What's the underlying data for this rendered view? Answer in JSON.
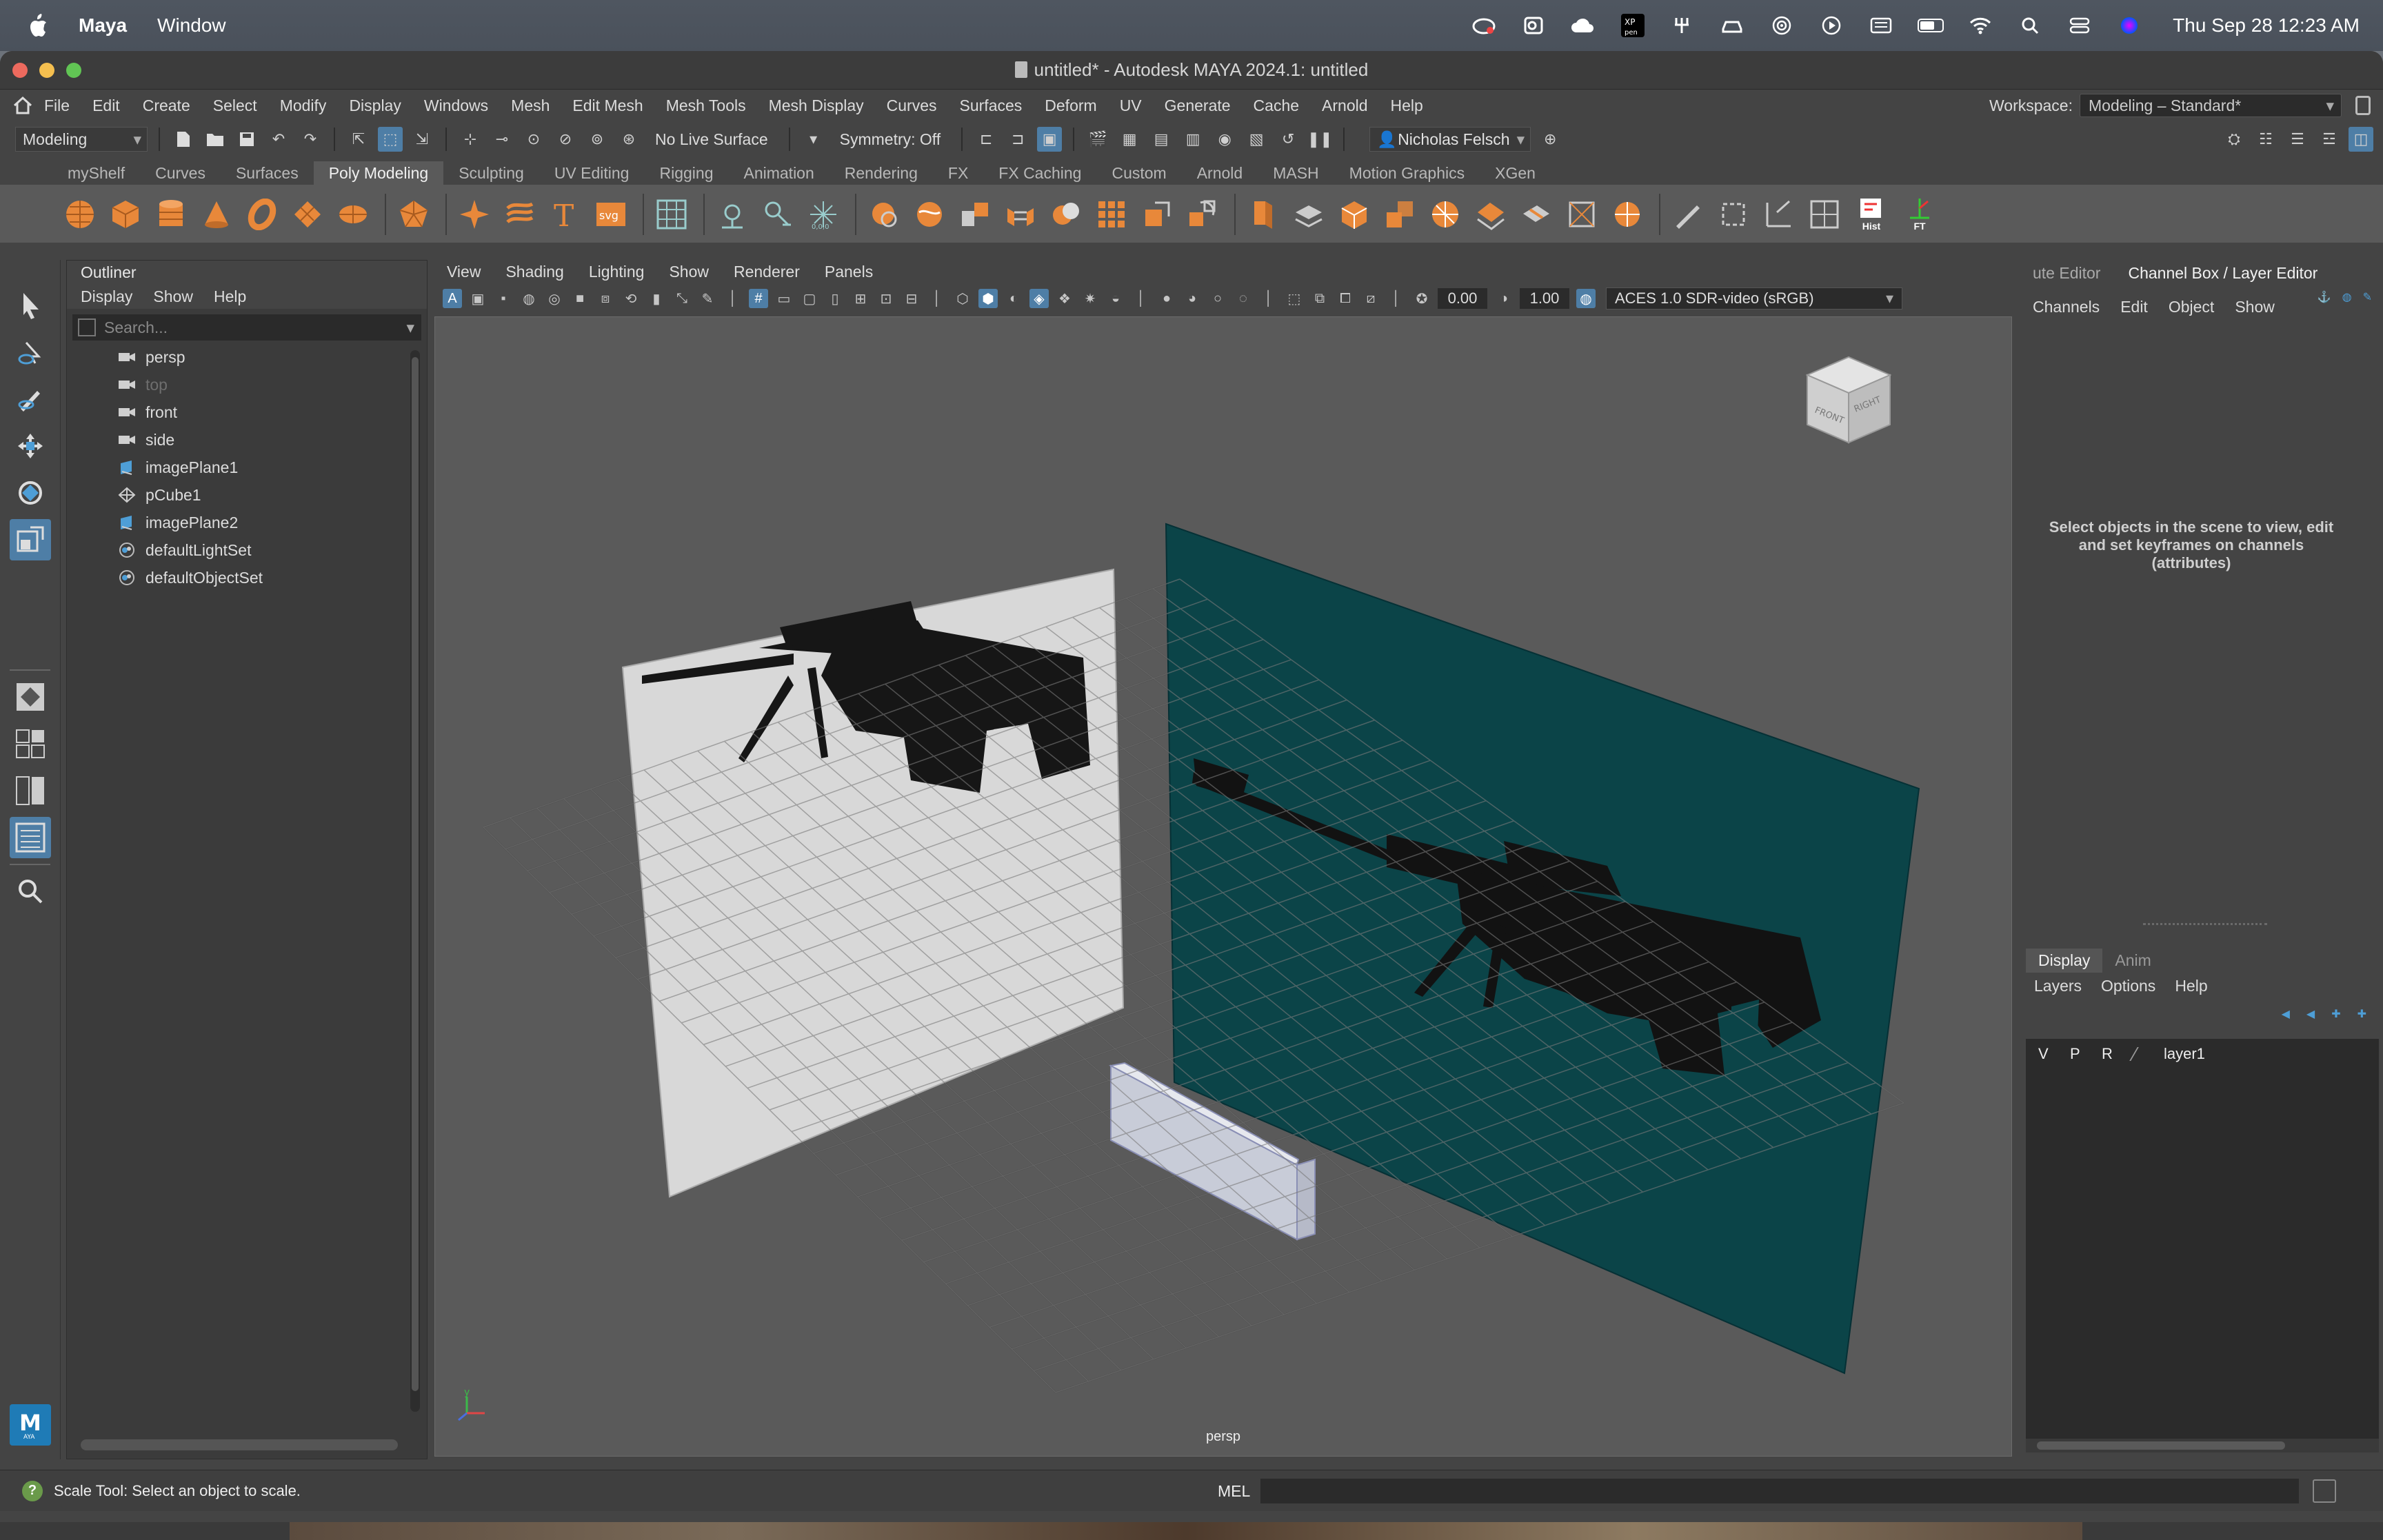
{
  "macbar": {
    "app": "Maya",
    "menu": [
      "Window"
    ],
    "clock": "Thu Sep 28  12:23 AM"
  },
  "window": {
    "title": "untitled* - Autodesk MAYA 2024.1: untitled"
  },
  "menubar": {
    "items": [
      "File",
      "Edit",
      "Create",
      "Select",
      "Modify",
      "Display",
      "Windows",
      "Mesh",
      "Edit Mesh",
      "Mesh Tools",
      "Mesh Display",
      "Curves",
      "Surfaces",
      "Deform",
      "UV",
      "Generate",
      "Cache",
      "Arnold",
      "Help"
    ],
    "workspace_label": "Workspace:",
    "workspace_value": "Modeling – Standard*"
  },
  "statusline": {
    "mode": "Modeling",
    "live_surface": "No Live Surface",
    "symmetry": "Symmetry: Off",
    "user": "Nicholas Felsch"
  },
  "shelf": {
    "tabs": [
      "myShelf",
      "Curves",
      "Surfaces",
      "Poly Modeling",
      "Sculpting",
      "UV Editing",
      "Rigging",
      "Animation",
      "Rendering",
      "FX",
      "FX Caching",
      "Custom",
      "Arnold",
      "MASH",
      "Motion Graphics",
      "XGen"
    ],
    "active_tab": "Poly Modeling",
    "hist_label": "Hist",
    "ft_label": "FT"
  },
  "outliner": {
    "title": "Outliner",
    "menu": [
      "Display",
      "Show",
      "Help"
    ],
    "search_placeholder": "Search...",
    "items": [
      {
        "label": "persp",
        "icon": "camera-icon",
        "dim": false
      },
      {
        "label": "top",
        "icon": "camera-icon",
        "dim": true
      },
      {
        "label": "front",
        "icon": "camera-icon",
        "dim": false
      },
      {
        "label": "side",
        "icon": "camera-icon",
        "dim": false
      },
      {
        "label": "imagePlane1",
        "icon": "image-plane-icon",
        "dim": false
      },
      {
        "label": "pCube1",
        "icon": "mesh-icon",
        "dim": false
      },
      {
        "label": "imagePlane2",
        "icon": "image-plane-icon",
        "dim": false
      },
      {
        "label": "defaultLightSet",
        "icon": "set-icon",
        "dim": false
      },
      {
        "label": "defaultObjectSet",
        "icon": "set-icon",
        "dim": false
      }
    ]
  },
  "viewport": {
    "menu": [
      "View",
      "Shading",
      "Lighting",
      "Show",
      "Renderer",
      "Panels"
    ],
    "exposure": "0.00",
    "gamma": "1.00",
    "colorspace": "ACES 1.0 SDR-video (sRGB)",
    "camera": "persp",
    "viewcube_front": "FRONT",
    "viewcube_right": "RIGHT"
  },
  "channelbox": {
    "tab_attr": "ute Editor",
    "tab_channel": "Channel Box / Layer Editor",
    "menu": [
      "Channels",
      "Edit",
      "Object",
      "Show"
    ],
    "message": "Select objects in the scene to view, edit and set keyframes on channels (attributes)",
    "layer_tabs": [
      "Display",
      "Anim"
    ],
    "layer_menu": [
      "Layers",
      "Options",
      "Help"
    ],
    "layer_cols": [
      "V",
      "P",
      "R"
    ],
    "layer_name": "layer1"
  },
  "helpline": {
    "text": "Scale Tool: Select an object to scale.",
    "mel": "MEL"
  },
  "colors": {
    "accent": "#4e7ea6",
    "shelf_icon": "#e8883a",
    "teal_plane": "#0b4448"
  }
}
